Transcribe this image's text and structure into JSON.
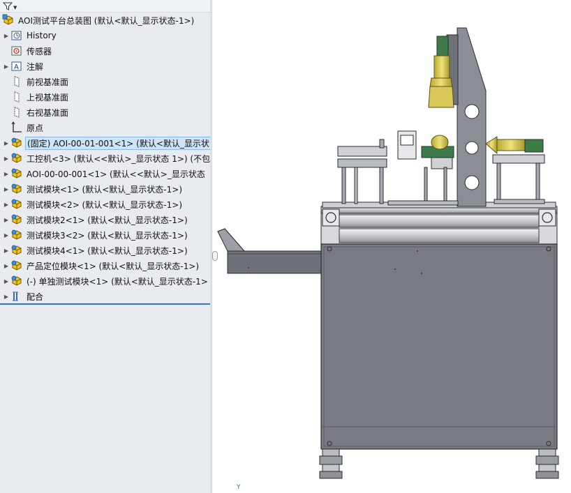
{
  "tree": {
    "root_label": "AOI测试平台总装图  (默认<默认_显示状态-1>)",
    "items": [
      {
        "label": "History",
        "icon": "history-icon",
        "expandable": true
      },
      {
        "label": "传感器",
        "icon": "sensor-icon",
        "expandable": false
      },
      {
        "label": "注解",
        "icon": "annotation-icon",
        "expandable": true
      },
      {
        "label": "前视基准面",
        "icon": "plane-icon",
        "expandable": false
      },
      {
        "label": "上视基准面",
        "icon": "plane-icon",
        "expandable": false
      },
      {
        "label": "右视基准面",
        "icon": "plane-icon",
        "expandable": false
      },
      {
        "label": "原点",
        "icon": "origin-icon",
        "expandable": false
      },
      {
        "label": "(固定) AOI-00-01-001<1> (默认<默认_显示状",
        "icon": "subassembly-icon",
        "expandable": true,
        "selected": true
      },
      {
        "label": "工控机<3> (默认<<默认>_显示状态 1>) (不包",
        "icon": "subassembly-icon",
        "expandable": true
      },
      {
        "label": "AOI-00-00-001<1> (默认<<默认>_显示状态",
        "icon": "subassembly-icon",
        "expandable": true
      },
      {
        "label": "测试模块<1> (默认<默认_显示状态-1>)",
        "icon": "subassembly-icon",
        "expandable": true
      },
      {
        "label": "测试模块<2> (默认<默认_显示状态-1>)",
        "icon": "subassembly-icon",
        "expandable": true
      },
      {
        "label": "测试模块2<1> (默认<默认_显示状态-1>)",
        "icon": "subassembly-icon",
        "expandable": true
      },
      {
        "label": "测试模块3<2> (默认<默认_显示状态-1>)",
        "icon": "subassembly-icon",
        "expandable": true
      },
      {
        "label": "测试模块4<1> (默认<默认_显示状态-1>)",
        "icon": "subassembly-icon",
        "expandable": true
      },
      {
        "label": "产品定位模块<1> (默认<默认_显示状态-1>)",
        "icon": "subassembly-icon",
        "expandable": true
      },
      {
        "label": "(-) 单独测试模块<1> (默认<默认_显示状态-1>",
        "icon": "subassembly-icon",
        "expandable": true
      },
      {
        "label": "配合",
        "icon": "mates-icon",
        "expandable": true
      }
    ]
  },
  "viewport": {
    "axis_label": "Y"
  },
  "colors": {
    "panel_bg": "#e8ecf1",
    "selection_bg": "#cde3f7",
    "accent": "#2b78c5",
    "cabinet_gray": "#777a80",
    "assembly_yellow": "#d8c85a"
  }
}
